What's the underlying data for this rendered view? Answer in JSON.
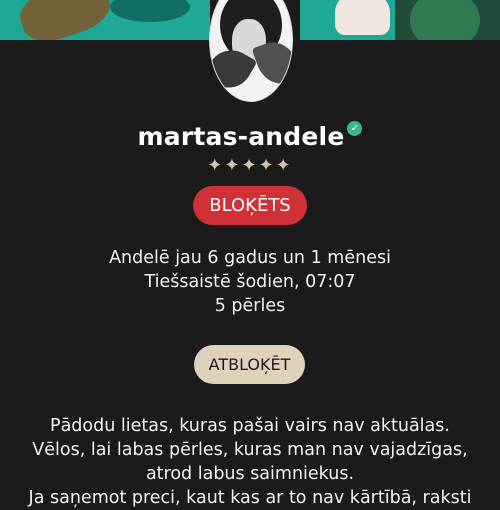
{
  "profile": {
    "username": "martas-andele",
    "rating_stars": "✦✦✦✦✦",
    "status_badge": "BLOĶĒTS",
    "member_since": "Andelē jau 6 gadus un 1 mēnesi",
    "last_online": "Tiešsaistē šodien, 07:07",
    "pearls": "5 pērles",
    "unblock_label": "ATBLOĶĒT",
    "bio_lines": [
      "Pādodu lietas, kuras pašai vairs nav aktuālas.",
      "Vēlos, lai labas pērles, kuras man nav vajadzīgas,",
      "atrod labus saimniekus.",
      "Ja saņemot preci, kaut kas ar to nav kārtībā, raksti"
    ]
  },
  "colors": {
    "background": "#1c1b1b",
    "blocked_badge": "#cf3137",
    "unblock_button": "#dfd2bd",
    "verified": "#3cb391",
    "stars": "#d1c1a6"
  },
  "icons": {
    "verified": "verified-check-icon"
  }
}
